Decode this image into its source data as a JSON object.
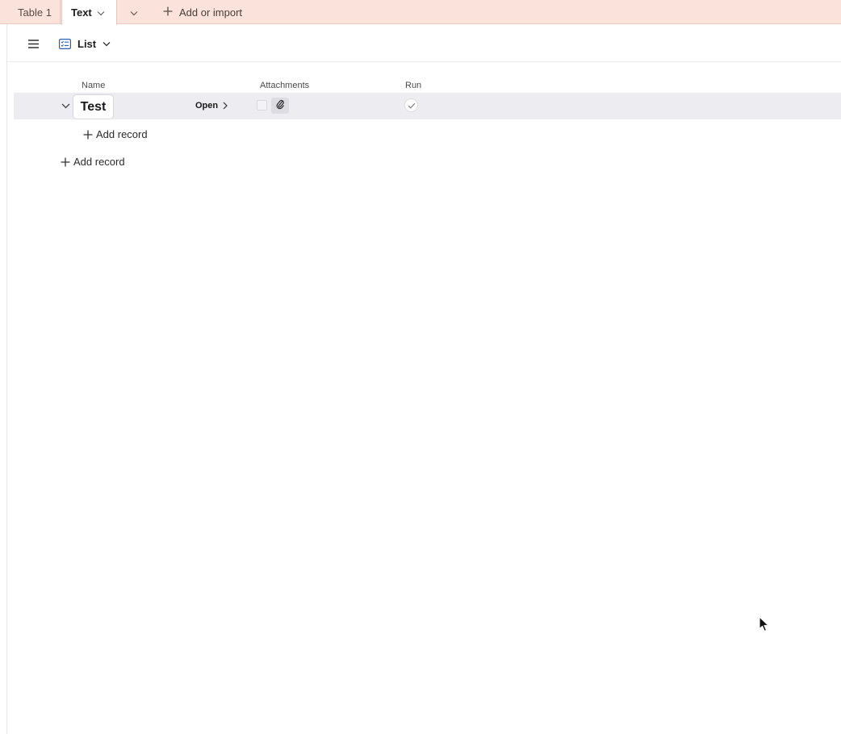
{
  "tabs": {
    "table1_label": "Table 1",
    "active_label": "Text",
    "add_label": "Add or import"
  },
  "toolbar": {
    "view_label": "List"
  },
  "columns": {
    "name": "Name",
    "attachments": "Attachments",
    "run": "Run"
  },
  "record": {
    "name": "Test",
    "open_label": "Open",
    "run_checked": true
  },
  "actions": {
    "add_record_nested": "Add record",
    "add_record": "Add record"
  },
  "icons": {
    "tab_dropdown": "chevron-down-icon",
    "tab_more": "chevron-down-icon",
    "add": "plus-icon",
    "menu": "hamburger-menu-icon",
    "view": "list-view-icon",
    "expand": "chevron-down-icon",
    "open": "chevron-right-icon",
    "attachment": "paperclip-icon",
    "run": "check-icon",
    "cursor": "mouse-pointer-icon"
  },
  "colors": {
    "tabbar_bg": "#fbe3dc",
    "row_bg": "#ececf1",
    "view_icon": "#2b5fb3"
  }
}
